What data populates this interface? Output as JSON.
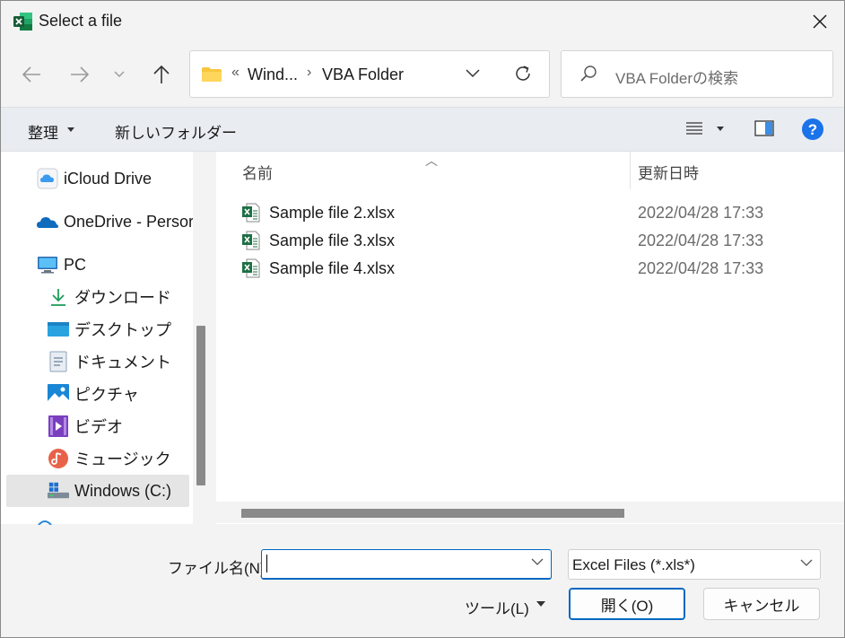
{
  "title": "Select a file",
  "address": {
    "overflow": "«",
    "crumbs": [
      "Wind...",
      "VBA Folder"
    ],
    "separator": "›"
  },
  "search": {
    "placeholder": "VBA Folderの検索"
  },
  "toolbar": {
    "organize": "整理",
    "new_folder": "新しいフォルダー"
  },
  "nav": {
    "items": [
      {
        "label": "iCloud Drive",
        "icon": "icloud-icon"
      },
      {
        "label": "OneDrive - Persor",
        "icon": "onedrive-icon"
      },
      {
        "label": "PC",
        "icon": "pc-icon"
      },
      {
        "label": "ダウンロード",
        "icon": "download-icon"
      },
      {
        "label": "デスクトップ",
        "icon": "desktop-icon"
      },
      {
        "label": "ドキュメント",
        "icon": "documents-icon"
      },
      {
        "label": "ピクチャ",
        "icon": "pictures-icon"
      },
      {
        "label": "ビデオ",
        "icon": "videos-icon"
      },
      {
        "label": "ミュージック",
        "icon": "music-icon"
      },
      {
        "label": "Windows (C:)",
        "icon": "drive-icon",
        "selected": true
      }
    ]
  },
  "columns": {
    "name": "名前",
    "date": "更新日時"
  },
  "files": [
    {
      "name": "Sample file 2.xlsx",
      "date": "2022/04/28 17:33"
    },
    {
      "name": "Sample file 3.xlsx",
      "date": "2022/04/28 17:33"
    },
    {
      "name": "Sample file 4.xlsx",
      "date": "2022/04/28 17:33"
    }
  ],
  "footer": {
    "filename_label": "ファイル名(N):",
    "filename_value": "",
    "filetype": "Excel Files (*.xls*)",
    "tools": "ツール(L)",
    "open": "開く(O)",
    "cancel": "キャンセル"
  },
  "colors": {
    "accent": "#0067c0",
    "excel_green": "#1d7044",
    "help_blue": "#1a73e8"
  }
}
